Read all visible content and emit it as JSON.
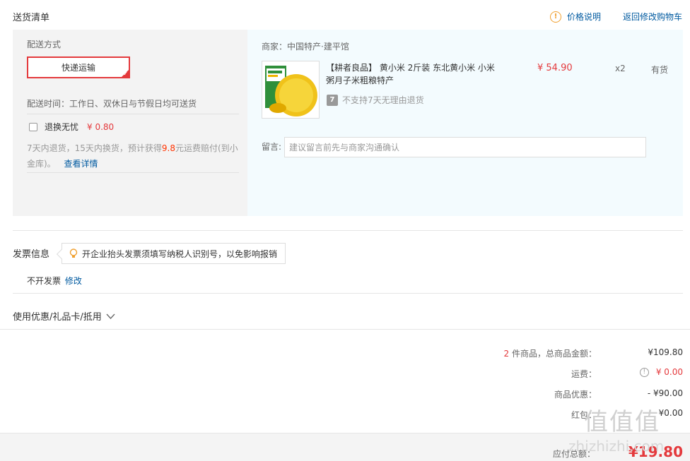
{
  "header": {
    "title": "送货清单",
    "price_explain": "价格说明",
    "back_cart": "返回修改购物车",
    "info_glyph": "!"
  },
  "shipping": {
    "label": "配送方式",
    "method": "快递运输",
    "time": "配送时间：工作日、双休日与节假日均可送货",
    "insurance_label": "退换无忧",
    "insurance_price": "¥ 0.80",
    "policy_part1": "7天内退货，15天内换货，预计获得",
    "policy_amount": "9.8",
    "policy_part2": "元运费赔付(到小",
    "policy_line2": "金库)。",
    "details_link": "查看详情"
  },
  "merchant": {
    "label": "商家：中国特产·建平馆"
  },
  "product": {
    "title_line1": "【耕者良品】 黄小米 2斤装 东北黄小米 小米",
    "title_line2": "粥月子米粗粮特产",
    "price": "¥ 54.90",
    "qty": "x2",
    "stock": "有货",
    "return_tag": "7",
    "return_policy": "不支持7天无理由退货"
  },
  "note": {
    "label": "留言:",
    "placeholder": "建议留言前先与商家沟通确认"
  },
  "invoice": {
    "title": "发票信息",
    "tip": "开企业抬头发票须填写纳税人识别号，以免影响报销",
    "status": "不开发票",
    "edit": "修改"
  },
  "coupon": {
    "label": "使用优惠/礼品卡/抵用"
  },
  "summary": {
    "count": "2",
    "items_label": "件商品，总商品金额：",
    "items_total": "¥109.80",
    "shipping_label": "运费：",
    "shipping_value": "¥ 0.00",
    "discount_label": "商品优惠：",
    "discount_value": "- ¥90.00",
    "redpacket_label": "红包：",
    "redpacket_value": "¥0.00",
    "total_label": "应付总额：",
    "total_value": "¥19.80"
  },
  "watermark": {
    "logo": "值值值",
    "url": "zhizhizhi.com"
  }
}
